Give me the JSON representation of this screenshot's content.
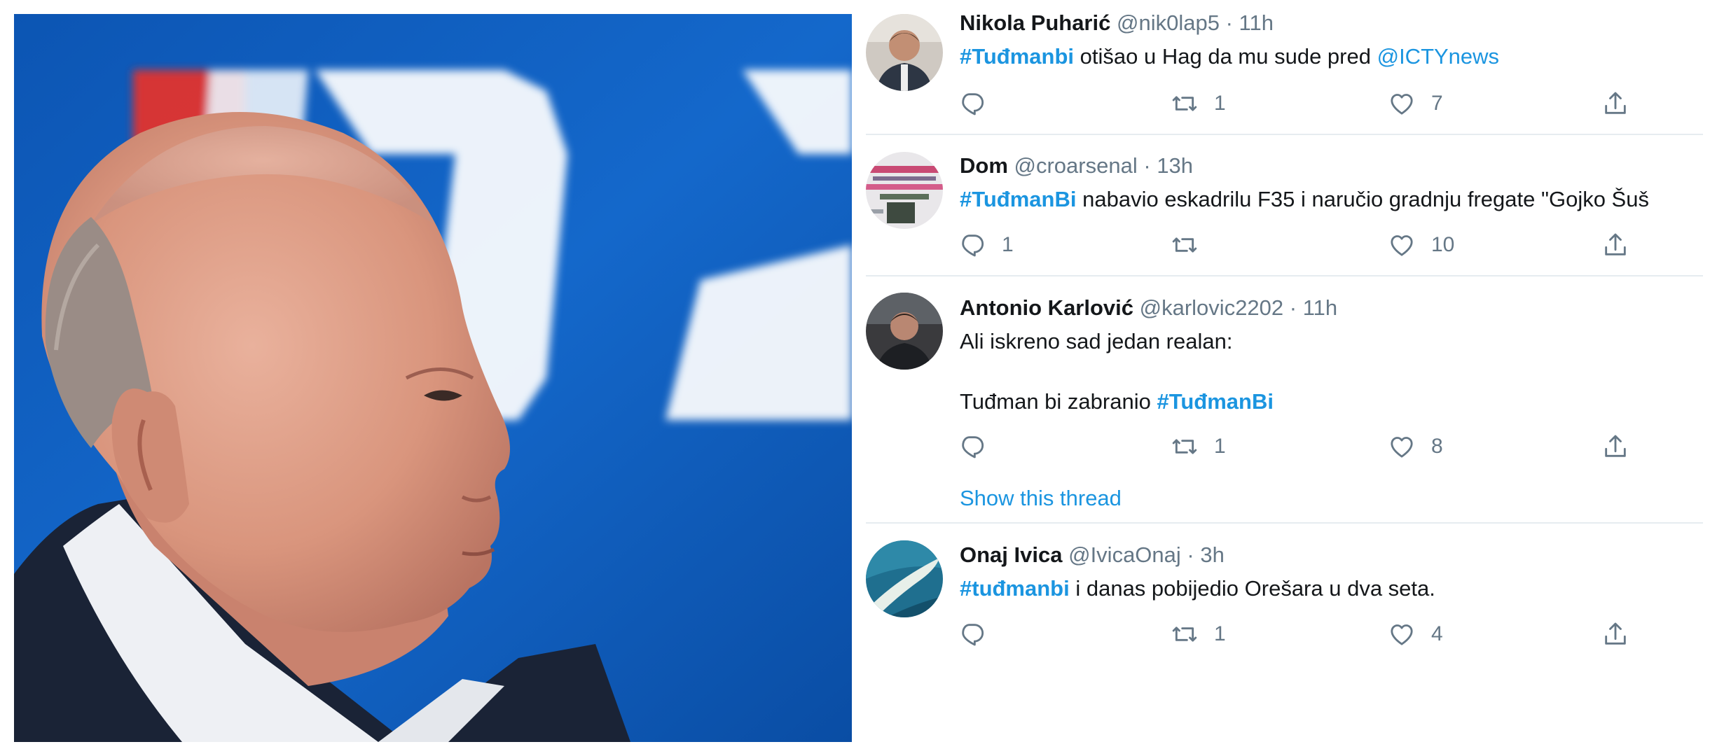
{
  "photo": {
    "logo_text": "HDZ",
    "logo_color": "#ffffff",
    "logo_accent": "#e8312b",
    "background_color": "#0c57b5"
  },
  "tweets": [
    {
      "name": "Nikola Puharić",
      "handle": "@nik0lap5",
      "sep": "·",
      "time": "11h",
      "line1": {
        "tag": "#Tuđmanbi",
        "text": " otišao u Hag da mu sude pred ",
        "mention": "@ICTYnews"
      },
      "reply_count": "",
      "retweet_count": "1",
      "like_count": "7"
    },
    {
      "name": "Dom",
      "handle": "@croarsenal",
      "sep": "·",
      "time": "13h",
      "line1": {
        "tag": "#TuđmanBi",
        "text": " nabavio eskadrilu F35 i naručio gradnju fregate \"Gojko Šuš"
      },
      "reply_count": "1",
      "retweet_count": "",
      "like_count": "10"
    },
    {
      "name": "Antonio Karlović",
      "handle": "@karlovic2202",
      "sep": "·",
      "time": "11h",
      "line1": {
        "text": "Ali iskreno sad jedan realan:"
      },
      "line2": {
        "text": "Tuđman bi zabranio ",
        "tag": "#TuđmanBi"
      },
      "reply_count": "",
      "retweet_count": "1",
      "like_count": "8",
      "show_thread": "Show this thread"
    },
    {
      "name": "Onaj Ivica",
      "handle": "@IvicaOnaj",
      "sep": "·",
      "time": "3h",
      "line1": {
        "tag": "#tuđmanbi",
        "text": " i danas pobijedio Orešara u dva seta."
      },
      "reply_count": "",
      "retweet_count": "1",
      "like_count": "4"
    }
  ],
  "icons": {
    "reply": "reply-icon",
    "retweet": "retweet-icon",
    "like": "heart-icon",
    "share": "share-icon"
  },
  "colors": {
    "link": "#1b95e0",
    "muted": "#657786",
    "divider": "#e6ecf0"
  }
}
